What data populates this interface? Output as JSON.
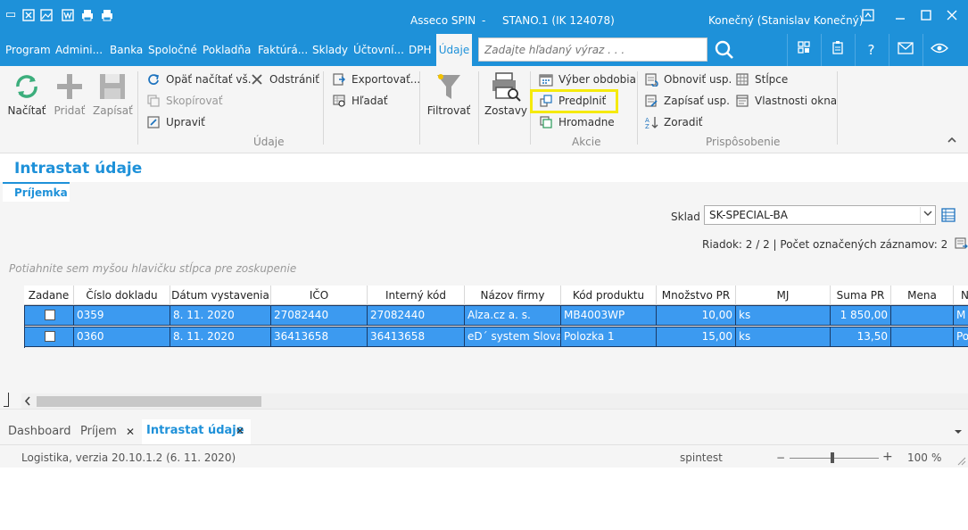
{
  "titlebar": {
    "app_name": "Asseco SPIN",
    "separator": "-",
    "company": "STANO.1 (IK 124078)",
    "user": "Konečný (Stanislav Konečný)"
  },
  "menu": {
    "items": [
      "Program",
      "Admini...",
      "Banka",
      "Spoločné",
      "Pokladňa",
      "Faktúrá...",
      "Sklady",
      "Účtovní...",
      "DPH"
    ],
    "active": "Údaje",
    "search_placeholder": "Zadajte hľadaný výraz . . ."
  },
  "ribbon": {
    "big_buttons": {
      "nacitat": "Načítať",
      "pridat": "Pridať",
      "zapisat": "Zapísať",
      "filtrovat": "Filtrovať",
      "zostavy": "Zostavy"
    },
    "small_buttons": {
      "opat_nacitat": "Opäť načítať vš.",
      "odstranit": "Odstrániť",
      "skopirovat": "Skopírovať",
      "upravit": "Upraviť",
      "exportovat": "Exportovať...",
      "hladat": "Hľadať",
      "vyber_obdobia": "Výber obdobia",
      "predplnit": "Predplniť",
      "hromadne": "Hromadne",
      "obnovit_usp": "Obnoviť usp.",
      "zapisat_usp": "Zapísať usp.",
      "zoradit": "Zoradiť",
      "stlpce": "Stĺpce",
      "vlastnosti_okna": "Vlastnosti okna"
    },
    "groups": {
      "udaje": "Údaje",
      "akcie": "Akcie",
      "prisposobenie": "Prispôsobenie"
    }
  },
  "page": {
    "title": "Intrastat údaje",
    "subtab": "Príjemka",
    "sklad_label": "Sklad",
    "sklad_value": "SK-SPECIAL-BA",
    "status_line": "Riadok: 2 / 2 | Počet označených záznamov: 2",
    "group_hint": "Potiahnite sem myšou hlavičku stĺpca pre zoskupenie"
  },
  "grid": {
    "columns": [
      "Zadane",
      "Číslo dokladu",
      "Dátum vystavenia",
      "IČO",
      "Interný kód",
      "Názov firmy",
      "Kód produktu",
      "Množstvo PR",
      "MJ",
      "Suma PR",
      "Mena",
      "N"
    ],
    "rows": [
      {
        "cislo": "0359",
        "datum": "8. 11. 2020",
        "ico": "27082440",
        "interny": "27082440",
        "nazov": "Alza.cz a. s.",
        "kod": "MB4003WP",
        "mnozstvo": "10,00",
        "mj": "ks",
        "suma": "1 850,00",
        "mena": "",
        "n": "M"
      },
      {
        "cislo": "0360",
        "datum": "8. 11. 2020",
        "ico": "36413658",
        "interny": "36413658",
        "nazov": "eD´ system  Slova...",
        "kod": "Polozka 1",
        "mnozstvo": "15,00",
        "mj": "ks",
        "suma": "13,50",
        "mena": "",
        "n": "Po"
      }
    ]
  },
  "bottom_tabs": {
    "dashboard": "Dashboard",
    "prijem": "Príjem",
    "intrastat": "Intrastat údaje",
    "close": "✕"
  },
  "statusbar": {
    "version": "Logistika, verzia 20.10.1.2 (6. 11. 2020)",
    "server": "spintest",
    "zoom_minus": "−",
    "zoom_plus": "+",
    "zoom": "100",
    "zoom_unit": "%"
  },
  "colors": {
    "accent": "#1e91d9",
    "selection": "#3c9af0",
    "highlight": "#f5ea0c"
  }
}
